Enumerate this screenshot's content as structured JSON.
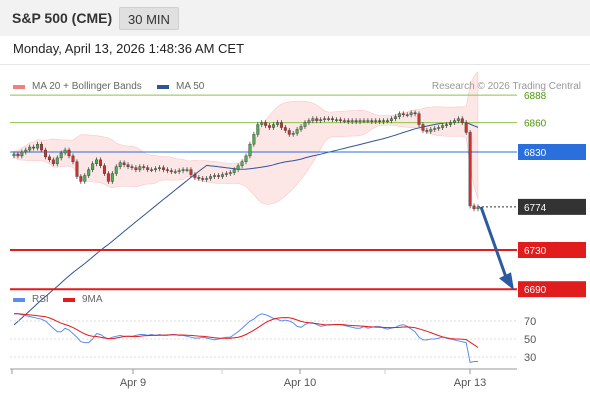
{
  "header": {
    "title": "S&P 500 (CME)",
    "interval": "30 MIN"
  },
  "datetime": "Monday, April 13, 2026 1:48:36 AM CET",
  "legend": {
    "bollinger": "MA 20 + Bollinger Bands",
    "ma50": "MA 50",
    "credit": "Research © 2026 Trading Central",
    "rsi": "RSI",
    "rsi_ma": "9MA"
  },
  "colors": {
    "bollinger": "#f08080",
    "ma50": "#2f5597",
    "resistance": "#2a6fdb",
    "support": "#e11c1c",
    "green_level": "#8bc34a",
    "last_price": "#333333",
    "candle_up": "#4caf50",
    "candle_down": "#d32f2f",
    "forecast_arrow": "#2a5aa0",
    "rsi": "#5b8def",
    "rsi_ma": "#e11c1c"
  },
  "levels": [
    {
      "label": "6888",
      "style": "green",
      "value": 6888
    },
    {
      "label": "6860",
      "style": "green",
      "value": 6860
    },
    {
      "label": "6830",
      "style": "blue",
      "value": 6830
    },
    {
      "label": "6774",
      "style": "dark",
      "value": 6774
    },
    {
      "label": "6730",
      "style": "red",
      "value": 6730
    },
    {
      "label": "6690",
      "style": "red",
      "value": 6690
    }
  ],
  "x_axis": {
    "labels": [
      "Apr 9",
      "Apr 10",
      "Apr 13"
    ]
  },
  "rsi_axis": {
    "labels": [
      "70",
      "50",
      "30"
    ]
  },
  "chart_data": {
    "type": "line",
    "title": "",
    "price_levels": [
      6888,
      6860,
      6830,
      6774,
      6730,
      6690
    ],
    "close": [
      6828,
      6826,
      6830,
      6832,
      6835,
      6834,
      6838,
      6832,
      6825,
      6822,
      6818,
      6824,
      6829,
      6832,
      6826,
      6820,
      6805,
      6800,
      6806,
      6812,
      6818,
      6822,
      6816,
      6808,
      6800,
      6808,
      6815,
      6819,
      6817,
      6815,
      6814,
      6812,
      6815,
      6814,
      6812,
      6812,
      6813,
      6814,
      6812,
      6811,
      6810,
      6810,
      6811,
      6812,
      6812,
      6807,
      6804,
      6803,
      6802,
      6803,
      6805,
      6806,
      6805,
      6807,
      6808,
      6809,
      6812,
      6816,
      6820,
      6826,
      6838,
      6848,
      6858,
      6860,
      6857,
      6855,
      6858,
      6860,
      6855,
      6852,
      6848,
      6849,
      6853,
      6856,
      6860,
      6862,
      6864,
      6862,
      6863,
      6864,
      6864,
      6863,
      6863,
      6862,
      6862,
      6861,
      6862,
      6861,
      6862,
      6862,
      6862,
      6861,
      6862,
      6861,
      6862,
      6862,
      6864,
      6866,
      6869,
      6868,
      6868,
      6870,
      6869,
      6858,
      6852,
      6851,
      6853,
      6854,
      6855,
      6857,
      6858,
      6860,
      6862,
      6864,
      6860,
      6850,
      6775,
      6772,
      6774
    ],
    "rsi": [
      78,
      78,
      77,
      76,
      75,
      74,
      73,
      72,
      70,
      66,
      62,
      58,
      58,
      62,
      60,
      56,
      52,
      47,
      46,
      46,
      50,
      56,
      55,
      52,
      50,
      52,
      53,
      54,
      53,
      53,
      53,
      54,
      55,
      55,
      54,
      55,
      54,
      55,
      54,
      54,
      55,
      55,
      54,
      54,
      53,
      52,
      51,
      51,
      52,
      51,
      50,
      49,
      50,
      51,
      52,
      52,
      55,
      58,
      62,
      66,
      70,
      72,
      76,
      78,
      77,
      75,
      73,
      72,
      70,
      71,
      70,
      68,
      64,
      63,
      66,
      68,
      68,
      66,
      64,
      65,
      66,
      66,
      66,
      66,
      65,
      64,
      63,
      62,
      62,
      64,
      62,
      63,
      64,
      64,
      62,
      61,
      62,
      63,
      65,
      66,
      64,
      61,
      58,
      52,
      49,
      49,
      50,
      50,
      51,
      52,
      51,
      50,
      49,
      48,
      47,
      46,
      24,
      25,
      25
    ],
    "xlabels": [
      "Apr 9",
      "Apr 10",
      "Apr 13"
    ],
    "series": [
      {
        "name": "MA 20 + Bollinger Bands"
      },
      {
        "name": "MA 50"
      },
      {
        "name": "RSI"
      },
      {
        "name": "9MA"
      }
    ],
    "rsi_ticks": [
      70,
      50,
      30
    ]
  }
}
